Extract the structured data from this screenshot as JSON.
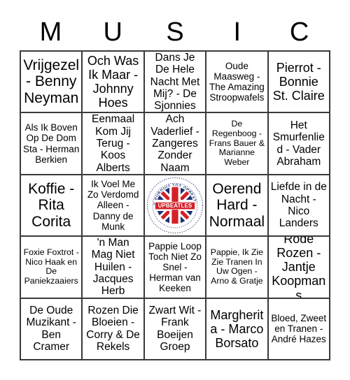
{
  "header": {
    "letters": [
      "M",
      "U",
      "S",
      "I",
      "C"
    ]
  },
  "colors": {
    "grid_line": "#3a3a3a",
    "background": "#ffffff",
    "text": "#000000",
    "logo_navy": "#1d2f6f",
    "logo_red": "#d42027",
    "logo_white": "#ffffff"
  },
  "free_space": {
    "type": "logo-image",
    "icon": "upbeatles-union-jack-logo",
    "banner_text": "UPBEATLES",
    "ring_text_top": "VAN PUBQUIZ TOT OPBEATLES",
    "ring_text_bottom": "Nederland"
  },
  "grid": {
    "rows": 5,
    "columns": 5,
    "cells": [
      [
        {
          "text": "Vrijgezel - Benny Neyman",
          "size": "fs-xl"
        },
        {
          "text": "Och Was Ik Maar - Johnny Hoes",
          "size": "fs-lg"
        },
        {
          "text": "Dans Je De Hele Nacht Met Mij? - De Sjonnies",
          "size": "fs-md"
        },
        {
          "text": "Oude Maasweg - The Amazing Stroopwafels",
          "size": "fs-sm"
        },
        {
          "text": "Pierrot - Bonnie St. Claire",
          "size": "fs-lg"
        }
      ],
      [
        {
          "text": "Als Ik Boven Op De Dom Sta - Herman Berkien",
          "size": "fs-sm"
        },
        {
          "text": "Eenmaal Kom Jij Terug - Koos Alberts",
          "size": "fs-md"
        },
        {
          "text": "Ach Vaderlief - Zangeres Zonder Naam",
          "size": "fs-md"
        },
        {
          "text": "De Regenboog - Frans Bauer & Marianne Weber",
          "size": "fs-xs"
        },
        {
          "text": "Het Smurfenlied - Vader Abraham",
          "size": "fs-md"
        }
      ],
      [
        {
          "text": "Koffie - Rita Corita",
          "size": "fs-xl"
        },
        {
          "text": "Ik Voel Me Zo Verdomd Alleen - Danny de Munk",
          "size": "fs-sm"
        },
        {
          "text": "",
          "size": "free"
        },
        {
          "text": "Oerend Hard - Normaal",
          "size": "fs-xl"
        },
        {
          "text": "Liefde in de Nacht - Nico Landers",
          "size": "fs-md"
        }
      ],
      [
        {
          "text": "Foxie Foxtrot - Nico Haak en De Paniekzaaiers",
          "size": "fs-xs"
        },
        {
          "text": "'n Man Mag Niet Huilen - Jacques Herb",
          "size": "fs-md"
        },
        {
          "text": "Pappie Loop Toch Niet Zo Snel - Herman van Keeken",
          "size": "fs-sm"
        },
        {
          "text": "Pappie, Ik Zie Zie Tranen In Uw Ogen - Arno & Gratje",
          "size": "fs-xs"
        },
        {
          "text": "Rode Rozen - Jantje Koopmans",
          "size": "fs-lg"
        }
      ],
      [
        {
          "text": "De Oude Muzikant - Ben Cramer",
          "size": "fs-md"
        },
        {
          "text": "Rozen Die Bloeien - Corry & De Rekels",
          "size": "fs-md"
        },
        {
          "text": "Zwart Wit - Frank Boeijen Groep",
          "size": "fs-md"
        },
        {
          "text": "Margherita - Marco Borsato",
          "size": "fs-lg"
        },
        {
          "text": "Bloed, Zweet en Tranen - André Hazes",
          "size": "fs-sm"
        }
      ]
    ]
  }
}
